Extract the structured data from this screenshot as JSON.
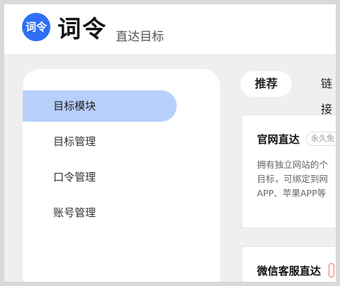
{
  "header": {
    "logo_text": "词令",
    "app_title": "词令",
    "app_subtitle": "直达目标"
  },
  "sidebar": {
    "items": [
      {
        "label": "目标模块",
        "active": true
      },
      {
        "label": "目标管理",
        "active": false
      },
      {
        "label": "口令管理",
        "active": false
      },
      {
        "label": "账号管理",
        "active": false
      }
    ]
  },
  "tabs": [
    {
      "label": "推荐",
      "active": true
    },
    {
      "label": "链接",
      "active": false
    }
  ],
  "cards": [
    {
      "title": "官网直达",
      "badge": "永久免",
      "description_lines": [
        "拥有独立网站的个",
        "目标，可绑定到网",
        "APP、苹果APP等"
      ]
    },
    {
      "title": "微信客服直达",
      "badge": ""
    }
  ],
  "colors": {
    "accent": "#2f6ef5",
    "active_nav": "#b7d0fb",
    "background": "#efeff1"
  }
}
